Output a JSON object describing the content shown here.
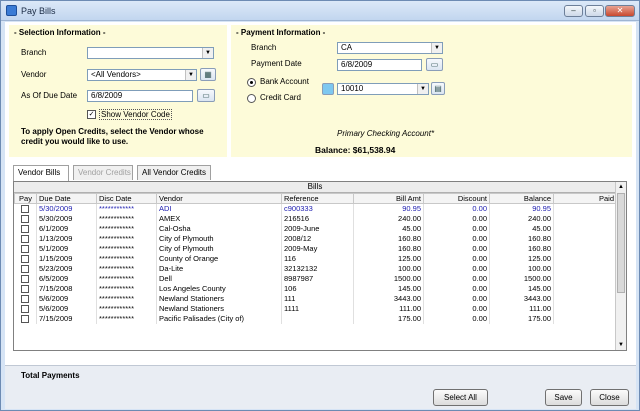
{
  "window": {
    "title": "Pay Bills",
    "min_glyph": "–",
    "max_glyph": "▫",
    "close_glyph": "✕"
  },
  "selection": {
    "heading": "- Selection Information -",
    "branch_label": "Branch",
    "branch_value": "",
    "vendor_label": "Vendor",
    "vendor_value": "<All Vendors>",
    "due_label": "As Of Due Date",
    "due_value": "6/8/2009",
    "show_vendor_code_label": "Show Vendor Code",
    "show_vendor_code_checked": "✓",
    "note": "To apply Open Credits, select the Vendor whose credit you would like to use."
  },
  "payment": {
    "heading": "- Payment Information -",
    "branch_label": "Branch",
    "branch_value": "CA",
    "date_label": "Payment Date",
    "date_value": "6/8/2009",
    "bank_label": "Bank Account",
    "bank_value": "10010",
    "card_label": "Credit Card",
    "account_name": "Primary Checking Account*",
    "balance_text": "Balance: $61,538.94"
  },
  "tabs": [
    {
      "label": "Vendor Bills"
    },
    {
      "label": "Vendor Credits"
    },
    {
      "label": "All Vendor Credits"
    }
  ],
  "grid": {
    "title": "Bills",
    "columns": [
      "Pay",
      "Due Date",
      "Disc Date",
      "Vendor",
      "Reference",
      "Bill Amt",
      "Discount",
      "Balance",
      "Paid"
    ],
    "rows": [
      [
        "5/30/2009",
        "************",
        "ADI",
        "c900333",
        "90.95",
        "0.00",
        "90.95",
        ""
      ],
      [
        "5/30/2009",
        "************",
        "AMEX",
        "216516",
        "240.00",
        "0.00",
        "240.00",
        ""
      ],
      [
        "6/1/2009",
        "************",
        "Cal-Osha",
        "2009-June",
        "45.00",
        "0.00",
        "45.00",
        ""
      ],
      [
        "1/13/2009",
        "************",
        "City of Plymouth",
        "2008/12",
        "160.80",
        "0.00",
        "160.80",
        ""
      ],
      [
        "5/1/2009",
        "************",
        "City of Plymouth",
        "2009-May",
        "160.80",
        "0.00",
        "160.80",
        ""
      ],
      [
        "1/15/2009",
        "************",
        "County of Orange",
        "116",
        "125.00",
        "0.00",
        "125.00",
        ""
      ],
      [
        "5/23/2009",
        "************",
        "Da-Lite",
        "32132132",
        "100.00",
        "0.00",
        "100.00",
        ""
      ],
      [
        "6/5/2009",
        "************",
        "Dell",
        "8987987",
        "1500.00",
        "0.00",
        "1500.00",
        ""
      ],
      [
        "7/15/2008",
        "************",
        "Los Angeles County",
        "106",
        "145.00",
        "0.00",
        "145.00",
        ""
      ],
      [
        "5/6/2009",
        "************",
        "Newland Stationers",
        "111",
        "3443.00",
        "0.00",
        "3443.00",
        ""
      ],
      [
        "5/6/2009",
        "************",
        "Newland Stationers",
        "1111",
        "111.00",
        "0.00",
        "111.00",
        ""
      ],
      [
        "7/15/2009",
        "************",
        "Pacific Palisades (City of)",
        "",
        "175.00",
        "0.00",
        "175.00",
        ""
      ]
    ]
  },
  "footer": {
    "total_label": "Total Payments",
    "select_all": "Select All",
    "save": "Save",
    "close": "Close"
  }
}
